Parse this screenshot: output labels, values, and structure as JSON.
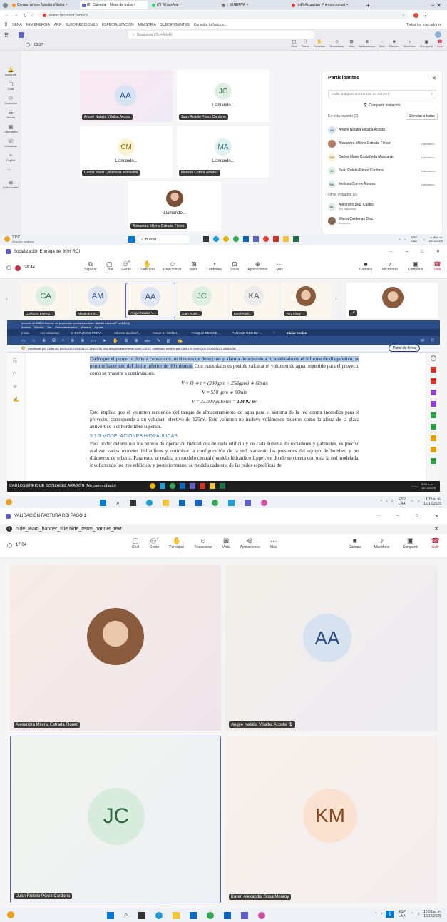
{
  "p1": {
    "tabs": [
      "Correo: Angye Natalia Villalba ×",
      "(6) Calendar | Mesa de traba ×",
      "(7) WhatsApp",
      "i: MINERVA ×",
      "(pdf) Actualizar Pre-conceptual ×"
    ],
    "url": "teams.microsoft.com/v2/",
    "bookmarks": [
      "SENA",
      "MIN ENERGIA",
      "ARF",
      "SUBDIRECCIONES",
      "ESPECIALIZACIÓN",
      "MINISTRIA",
      "SUBDIRIGENTES",
      "Consulta tu factura..."
    ],
    "bookmarks_right": "Todos los marcadores",
    "search_placeholder": "Búsqueda (Ctrl+Alt+E)",
    "timer": "03:27",
    "rail": [
      "Actividad",
      "Chat",
      "Contactos",
      "Teams",
      "Calendario",
      "Llamadas",
      "Copilot",
      "Aplicaciones"
    ],
    "top_actions": [
      "Chat",
      "Gente",
      "Participar",
      "Reaccionar",
      "Vista",
      "Aplicaciones",
      "Más",
      "Cámara",
      "Micrófono",
      "Compartir",
      "Salir"
    ],
    "tiles": [
      {
        "initials": "AA",
        "name": "Angye Natalia Villalba Acosta",
        "status": "",
        "bg": "#fae8ef",
        "av_bg": "#d7e4f4",
        "av_color": "#2b5c9b"
      },
      {
        "initials": "JC",
        "name": "Juan Rutelio Pérez Cardona",
        "status": "Llamando...",
        "bg": "#ffffff",
        "av_bg": "#e0efe3",
        "av_color": "#3b7a4c"
      },
      {
        "initials": "CM",
        "name": "Carlos Mario Casañeda Monsalve",
        "status": "Llamando...",
        "bg": "#ffffff",
        "av_bg": "#fbf3d0",
        "av_color": "#8c6a00"
      },
      {
        "initials": "MÁ",
        "name": "Melissa Correa Álvarez",
        "status": "Llamando...",
        "bg": "#ffffff",
        "av_bg": "#dff0f0",
        "av_color": "#2f7a7a"
      },
      {
        "initials": "",
        "name": "Alexandra Milena Estrada Florez",
        "status": "Llamando...",
        "bg": "#ffffff",
        "av_bg": "#b57e66",
        "av_color": "#fff"
      }
    ],
    "people": {
      "title": "Participantes",
      "search_placeholder": "Invite a alguien o marque un número",
      "share": "Compartir invitación",
      "in_meeting": "En esta reunión (2)",
      "mute_all": "Silenciar a todos",
      "list": [
        {
          "initials": "AA",
          "name": "Angye Natalia Villalba Acosta",
          "right": "",
          "color": "#d7e4f4"
        },
        {
          "initials": "",
          "name": "Alexandra Milena Estrada Florez",
          "right": "Llamando...",
          "color": "#b57e66"
        },
        {
          "initials": "CM",
          "name": "Carlos Mario Castañeda Monsalve",
          "right": "Llamando...",
          "color": "#fbf3d0"
        },
        {
          "initials": "JC",
          "name": "Juan Rutelio Pérez Cardona",
          "right": "Llamando...",
          "color": "#e0efe3"
        },
        {
          "initials": "MA",
          "name": "Melissa Correa Álvarez",
          "right": "Llamando...",
          "color": "#dff0f0"
        }
      ],
      "others": "Otros invitados (2)",
      "others_list": [
        {
          "initials": "AC",
          "name": "Alejandro Diaz Castro",
          "sub": "Sin respuesta",
          "color": "#e0efe3"
        },
        {
          "initials": "",
          "name": "Eliana Cardenas Diaz",
          "sub": "Aceptado",
          "color": "#8a6a55"
        }
      ]
    },
    "weather": "21°C",
    "weather_sub": "Mayorm. soleado",
    "search_taskbar": "Buscar",
    "lang": "ESP LAA",
    "time": "4:36 p. m.",
    "date": "10/12/2025"
  },
  "p2": {
    "title": "Socialización Entrega del 80% RCI",
    "timer": "28:44",
    "actions": [
      "Separar",
      "Chat",
      "Gente",
      "Participar",
      "Reaccionar",
      "Vista",
      "Controles",
      "Salas",
      "Aplicaciones",
      "Más",
      "Cámara",
      "Micrófono",
      "Compartir",
      "Salir"
    ],
    "people_count": "9",
    "strip": [
      {
        "initials": "CA",
        "name": "CARLOS ENRIQ...",
        "av_bg": "#dcefe2",
        "color": "#2c6e44"
      },
      {
        "initials": "AM",
        "name": "Alexandra S...",
        "av_bg": "#dde4f2",
        "color": "#33508a"
      },
      {
        "initials": "AA",
        "name": "Angye Natalia V...",
        "av_bg": "#dde4f2",
        "color": "#33508a"
      },
      {
        "initials": "JC",
        "name": "Juan Rutel...",
        "av_bg": "#dcefe2",
        "color": "#2c6e44"
      },
      {
        "initials": "KA",
        "name": "Karol Andr...",
        "av_bg": "#ececec",
        "color": "#555"
      },
      {
        "initials": "",
        "name": "Yery Liney ...",
        "av_bg": "#c99b80",
        "color": "#fff"
      }
    ],
    "pdf": {
      "window_title": "Informe de 80RCI informe de protección contra incendios - Adobe Acrobat Pro (64-bit)",
      "menu": [
        "Archivo",
        "Edición",
        "Ver",
        "Firma electrónica",
        "Ventana",
        "Ayuda"
      ],
      "tabs": [
        "Inicio",
        "Herramientas",
        "3. ESTUDIOS PREV...",
        "Informe de diseñ...",
        "Anexo 8 - MEMO...",
        "TANQUE RED DE ...",
        "TANQUE RED DE ..."
      ],
      "signin": "Iniciar sesión",
      "zoom": "65%",
      "page": "7 / 4",
      "cert": "Certificado por CARLOS ENRIQUE GONZÁLEZ ARAGÓN <ing.aragonzalez@gmail.com>, CEAT, certificado emitido por CARLOS ENRIQUE GONZÁLEZ ARAGÓN.",
      "sign_panel": "Panel de firma",
      "highlight": "Dado que el proyecto deberá contar con un sistema de detección y alarma de acuerdo a lo analizado en el informe de diagnóstico, se permite hacer uso del límite inferior de 60 minutos.",
      "para1_rest": " Con estos datos es posible calcular el volumen de agua requerido para el proyecto como se muestra a continuación.",
      "eq1": "V = Q ∗ t = (300gpm + 250gpm) ∗ 60min",
      "eq2": "V = 550 gpm ∗ 60min",
      "eq3_a": "V = 33.000 galones = ",
      "eq3_b": "124.92 m³",
      "para2": "Esto implica que el volumen requerido del tanque de almacenamiento de agua para el sistema de la red contra incendios para el proyecto, corresponde a un volumen efectivo de 125m³. Este volumen no incluye volúmenes muertos como la altura de la placa antivórtice o el borde libre superior.",
      "section": "5.1.3   MODELACIONES HIDRÁULICAS",
      "para3": "Para poder determinar los puntos de operación hidráulicos de cada edificio y de cada sistema de rociadores y gabinetes, es preciso realizar varios modelos hidráulicos y optimizar la configuración de la red, variando las presiones del equipo de bombeo y los diámetros de tubería. Para esto, se realiza un modelo central (modelo hidráulico 1.ppe), en donde se cuenta con toda la red modelada, involucrando los tres edificios, y posteriormente, se modela cada una de las redes específicas de"
    },
    "presenter": "CARLOS ENRIQUE GONZÁLEZ ARAGÓN (No comprobado)",
    "inner_time": "8:35 a. m.",
    "inner_date": "12/12/2025",
    "lang": "ESP LAA",
    "time": "8:35 a. m.",
    "date": "12/12/2025"
  },
  "p3": {
    "title": "VALIDACIÓN FACTURA RCI PAGO 1",
    "banner": "hide_team_banner_title hide_team_banner_text",
    "timer": "17:04",
    "people_count": "4",
    "actions": [
      "Chat",
      "Gente",
      "Participar",
      "Reaccionar",
      "Vista",
      "Aplicaciones",
      "Más",
      "Cámara",
      "Micrófono",
      "Compartir",
      "Salir"
    ],
    "tiles": [
      {
        "initials": "",
        "name": "Alexandra Milena Estrada Florez",
        "bg": "#f3ebe6",
        "av_bg": "#c08b6f",
        "color": "#fff",
        "muted": false
      },
      {
        "initials": "AA",
        "name": "Angye Natalia Villalba Acosta",
        "bg": "#f0eeeb",
        "av_bg": "#d7e2f1",
        "color": "#2d4f86",
        "muted": true
      },
      {
        "initials": "JC",
        "name": "Juan Rutelio Pérez Cardona",
        "bg": "#f0f4ee",
        "av_bg": "#d7ecdc",
        "color": "#2e6a40",
        "muted": false
      },
      {
        "initials": "KM",
        "name": "Karen Alexandra Sosa Monroy",
        "bg": "#f7f1ec",
        "av_bg": "#fbe1cf",
        "color": "#8a4a1e",
        "muted": false
      }
    ],
    "lang": "ESP LAA",
    "time": "10:08 a. m.",
    "date": "10/12/2025"
  }
}
